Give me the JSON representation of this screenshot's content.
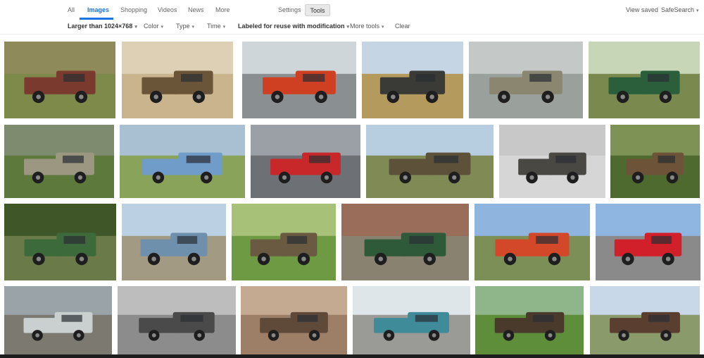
{
  "nav": {
    "tabs": [
      {
        "label": "All"
      },
      {
        "label": "Images"
      },
      {
        "label": "Shopping"
      },
      {
        "label": "Videos"
      },
      {
        "label": "News"
      },
      {
        "label": "More"
      }
    ],
    "settings_label": "Settings",
    "tools_label": "Tools",
    "view_saved_label": "View saved",
    "safesearch_label": "SafeSearch"
  },
  "filters": {
    "size": "Larger than 1024×768",
    "color": "Color",
    "type": "Type",
    "time": "Time",
    "usage_rights": "Labeled for reuse with modification",
    "more_tools": "More tools",
    "clear": "Clear"
  },
  "results": {
    "rows": [
      [
        {
          "subject": "rusty red pickup in field",
          "bg": "#7d8a4a",
          "sky": "#8e8a5a",
          "truck": "#7a3a2e"
        },
        {
          "subject": "sepia vintage box truck",
          "bg": "#c9b48e",
          "sky": "#ddd0b4",
          "truck": "#6b5538"
        },
        {
          "subject": "red and black stake truck",
          "bg": "#8a8f92",
          "sky": "#cfd6da",
          "truck": "#cf3f22"
        },
        {
          "subject": "abandoned truck in dry grass",
          "bg": "#b59a5e",
          "sky": "#c6d5e4",
          "truck": "#3a3b36"
        },
        {
          "subject": "rusty truck by garage",
          "bg": "#9aa09b",
          "sky": "#c4c9c7",
          "truck": "#8b8670"
        },
        {
          "subject": "green flatbed truck with load",
          "bg": "#7a8a4e",
          "sky": "#c8d6b8",
          "truck": "#2b5e3a"
        }
      ],
      [
        {
          "subject": "rusty truck grille in weeds",
          "bg": "#5d7a3c",
          "sky": "#7f8b6e",
          "truck": "#9b9780"
        },
        {
          "subject": "blue truck in field",
          "bg": "#8aa35a",
          "sky": "#a9c0d3",
          "truck": "#6f9cc8"
        },
        {
          "subject": "red truck front close up",
          "bg": "#6d7074",
          "sky": "#9aa0a6",
          "truck": "#c8282a"
        },
        {
          "subject": "army green cargo truck",
          "bg": "#7f8a55",
          "sky": "#b7cde0",
          "truck": "#5d513a"
        },
        {
          "subject": "grey flatbed truck studio",
          "bg": "#d6d6d6",
          "sky": "#c8c8c8",
          "truck": "#4a4843"
        },
        {
          "subject": "rusty truck in green brush",
          "bg": "#4e6a2f",
          "sky": "#7e9255",
          "truck": "#6d5338"
        }
      ],
      [
        {
          "subject": "green stake truck by trees",
          "bg": "#6a7a48",
          "sky": "#3f5628",
          "truck": "#3d6a3b"
        },
        {
          "subject": "blue and orange cab over",
          "bg": "#a39a83",
          "sky": "#bcd0e4",
          "truck": "#6e90ad"
        },
        {
          "subject": "rusty truck in meadow",
          "bg": "#6f9a44",
          "sky": "#a7c178",
          "truck": "#6a5a42"
        },
        {
          "subject": "green truck by rocks",
          "bg": "#8a8270",
          "sky": "#9a6d5a",
          "truck": "#2f5a3a"
        },
        {
          "subject": "red and black pickup",
          "bg": "#7c8f56",
          "sky": "#8fb5de",
          "truck": "#d4482a"
        },
        {
          "subject": "red fire trucks",
          "bg": "#8a8a8a",
          "sky": "#8fb6e0",
          "truck": "#d1202a"
        }
      ],
      [
        {
          "subject": "white and blue old truck",
          "bg": "#7c7a70",
          "sky": "#9aa4a8",
          "truck": "#c9d0cf"
        },
        {
          "subject": "black and white dump truck",
          "bg": "#8c8c8c",
          "sky": "#bdbdbd",
          "truck": "#4a4a4a"
        },
        {
          "subject": "truck window close up",
          "bg": "#9d7f68",
          "sky": "#c4aa90",
          "truck": "#5f4a3a"
        },
        {
          "subject": "teal and rust pickup",
          "bg": "#9a9a96",
          "sky": "#dfe6ea",
          "truck": "#3f8b9a"
        },
        {
          "subject": "rusty truck on grass",
          "bg": "#5e8e3a",
          "sky": "#8fb58a",
          "truck": "#4a3a2c"
        },
        {
          "subject": "rusty tow truck",
          "bg": "#8a9a6a",
          "sky": "#c9d8e8",
          "truck": "#5a3f30"
        }
      ]
    ]
  }
}
